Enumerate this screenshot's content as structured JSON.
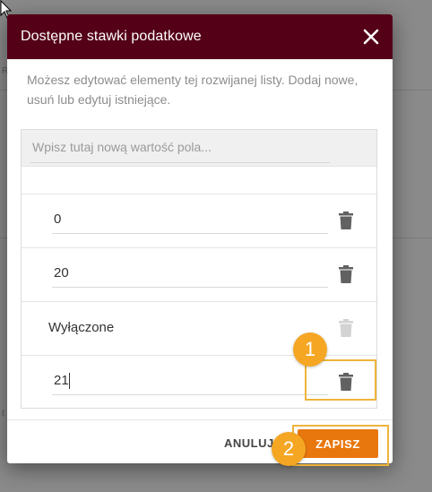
{
  "dialog": {
    "title": "Dostępne stawki podatkowe",
    "description": "Możesz edytować elementy tej rozwijanej listy. Dodaj nowe, usuń lub edytuj istniejące.",
    "new_value_placeholder": "Wpisz tutaj nową wartość pola...",
    "new_value_current": "",
    "close_icon": "close-icon",
    "header_color": "#540017"
  },
  "values": [
    {
      "value": "0",
      "editable": true,
      "delete_enabled": true
    },
    {
      "value": "20",
      "editable": true,
      "delete_enabled": true
    },
    {
      "value": "Wyłączone",
      "editable": false,
      "delete_enabled": false
    },
    {
      "value": "21",
      "editable": true,
      "delete_enabled": true
    }
  ],
  "footer": {
    "cancel_label": "ANULUJ",
    "save_label": "ZAPISZ",
    "save_color": "#e8770e"
  },
  "steps": [
    {
      "number": "1",
      "target": "delete-button-row-4"
    },
    {
      "number": "2",
      "target": "save-button"
    }
  ],
  "background": {
    "fragment_left": "R",
    "fragment_right": "t"
  }
}
